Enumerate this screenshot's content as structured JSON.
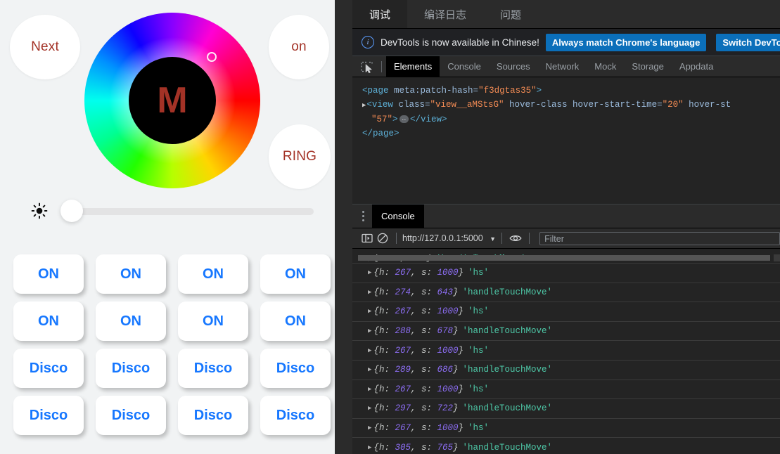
{
  "device": {
    "buttons": {
      "next": "Next",
      "on": "on",
      "ring": "RING"
    },
    "color_wheel": {
      "hub_label": "M",
      "hub_text_color": "#a33226",
      "cursor_visible": true
    },
    "slider": {
      "icon": "brightness-sun-icon",
      "value_percent": 0
    },
    "grid_buttons": [
      "ON",
      "ON",
      "ON",
      "ON",
      "ON",
      "ON",
      "ON",
      "ON",
      "Disco",
      "Disco",
      "Disco",
      "Disco",
      "Disco",
      "Disco",
      "Disco",
      "Disco"
    ],
    "accent_color": "#1677ff"
  },
  "devtools": {
    "top_tabs": [
      {
        "label": "调试",
        "active": true
      },
      {
        "label": "编译日志",
        "active": false
      },
      {
        "label": "问题",
        "active": false
      }
    ],
    "notice": {
      "icon": "info-icon",
      "text": "DevTools is now available in Chinese!",
      "buttons": [
        "Always match Chrome's language",
        "Switch DevTools to Chinese"
      ]
    },
    "panel_tabs": [
      {
        "label": "Elements",
        "active": true
      },
      {
        "label": "Console",
        "active": false
      },
      {
        "label": "Sources",
        "active": false
      },
      {
        "label": "Network",
        "active": false
      },
      {
        "label": "Mock",
        "active": false
      },
      {
        "label": "Storage",
        "active": false
      },
      {
        "label": "Appdata",
        "active": false
      }
    ],
    "inspect_icon": "inspect-element-icon",
    "dom_tree": {
      "line1": {
        "tag_open": "<page",
        "attr": "meta:patch-hash=",
        "value": "\"f3dgtas35\"",
        "tag_close": ">"
      },
      "line2": {
        "tag_open": "<view",
        "attr1": "class=",
        "val1": "\"view__aMStsG\"",
        "attr2": "hover-class",
        "attr3": "hover-start-time=",
        "val3": "\"20\"",
        "attr4": "hover-st"
      },
      "line3": {
        "value": "\"57\"",
        "tag_close": ">",
        "collapsed": "…",
        "end": "</view>"
      },
      "line4": {
        "end": "</page>"
      }
    },
    "drawer": {
      "tab_label": "Console",
      "context": "http://127.0.0.1:5000",
      "filter_placeholder": "Filter",
      "icons": [
        "sidebar-toggle-icon",
        "clear-console-icon",
        "eye-icon"
      ]
    },
    "console_rows": [
      {
        "clipped": true,
        "h": null,
        "s": null,
        "label": "handleTouchMove"
      },
      {
        "clipped": false,
        "h": "267",
        "s": "1000",
        "label": "hs"
      },
      {
        "clipped": false,
        "h": "274",
        "s": "643",
        "label": "handleTouchMove"
      },
      {
        "clipped": false,
        "h": "267",
        "s": "1000",
        "label": "hs"
      },
      {
        "clipped": false,
        "h": "288",
        "s": "678",
        "label": "handleTouchMove"
      },
      {
        "clipped": false,
        "h": "267",
        "s": "1000",
        "label": "hs"
      },
      {
        "clipped": false,
        "h": "289",
        "s": "686",
        "label": "handleTouchMove"
      },
      {
        "clipped": false,
        "h": "267",
        "s": "1000",
        "label": "hs"
      },
      {
        "clipped": false,
        "h": "297",
        "s": "722",
        "label": "handleTouchMove"
      },
      {
        "clipped": false,
        "h": "267",
        "s": "1000",
        "label": "hs"
      },
      {
        "clipped": false,
        "h": "305",
        "s": "765",
        "label": "handleTouchMove"
      }
    ],
    "colors": {
      "panel_bg": "#242424",
      "tabbar_bg": "#2b2b2b",
      "button_blue": "#0b6fba",
      "string_green": "#4ec9a8",
      "number_purple": "#8d6ef5"
    }
  }
}
